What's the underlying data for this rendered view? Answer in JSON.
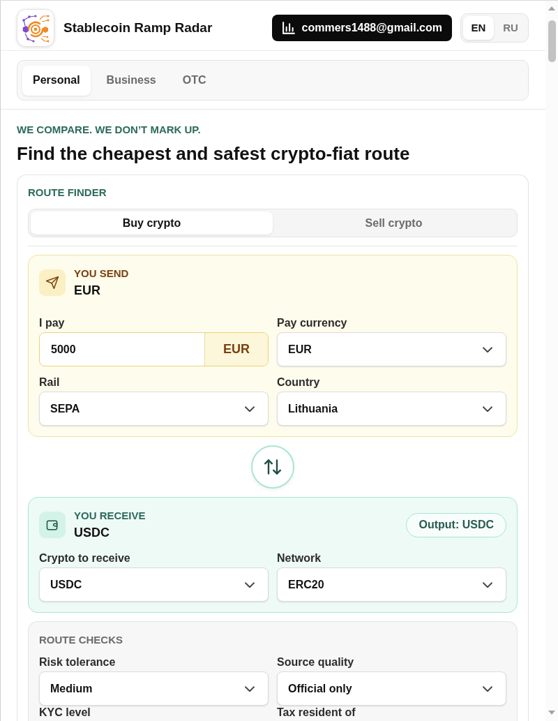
{
  "header": {
    "app_title": "Stablecoin Ramp Radar",
    "account_button": "commers1488@gmail.com",
    "languages": [
      {
        "label": "EN",
        "selected": true
      },
      {
        "label": "RU",
        "selected": false
      }
    ]
  },
  "segments": [
    {
      "label": "Personal",
      "selected": true
    },
    {
      "label": "Business",
      "selected": false
    },
    {
      "label": "OTC",
      "selected": false
    }
  ],
  "hero": {
    "eyebrow": "WE COMPARE. WE DON’T MARK UP.",
    "title": "Find the cheapest and safest crypto-fiat route"
  },
  "route_finder": {
    "title": "ROUTE FINDER",
    "modes": [
      {
        "label": "Buy crypto",
        "selected": true
      },
      {
        "label": "Sell crypto",
        "selected": false
      }
    ],
    "panels": [
      {
        "kind": "send",
        "label": "YOU SEND",
        "currency": "EUR",
        "fields": [
          {
            "kind": "amount",
            "label": "I pay",
            "value": "5000",
            "unit": "EUR"
          },
          {
            "kind": "select",
            "label": "Pay currency",
            "value": "EUR"
          },
          {
            "kind": "select",
            "label": "Rail",
            "value": "SEPA"
          },
          {
            "kind": "select",
            "label": "Country",
            "value": "Lithuania"
          }
        ]
      },
      {
        "kind": "receive",
        "label": "YOU RECEIVE",
        "currency": "USDC",
        "badge": "Output: USDC",
        "fields": [
          {
            "kind": "select",
            "label": "Crypto to receive",
            "value": "USDC"
          },
          {
            "kind": "select",
            "label": "Network",
            "value": "ERC20"
          }
        ]
      }
    ],
    "route_checks": {
      "title": "ROUTE CHECKS",
      "fields": [
        {
          "kind": "select",
          "label": "Risk tolerance",
          "value": "Medium"
        },
        {
          "kind": "select",
          "label": "Source quality",
          "value": "Official only"
        },
        {
          "kind": "label",
          "label": "KYC level"
        },
        {
          "kind": "label",
          "label": "Tax resident of"
        }
      ]
    }
  }
}
